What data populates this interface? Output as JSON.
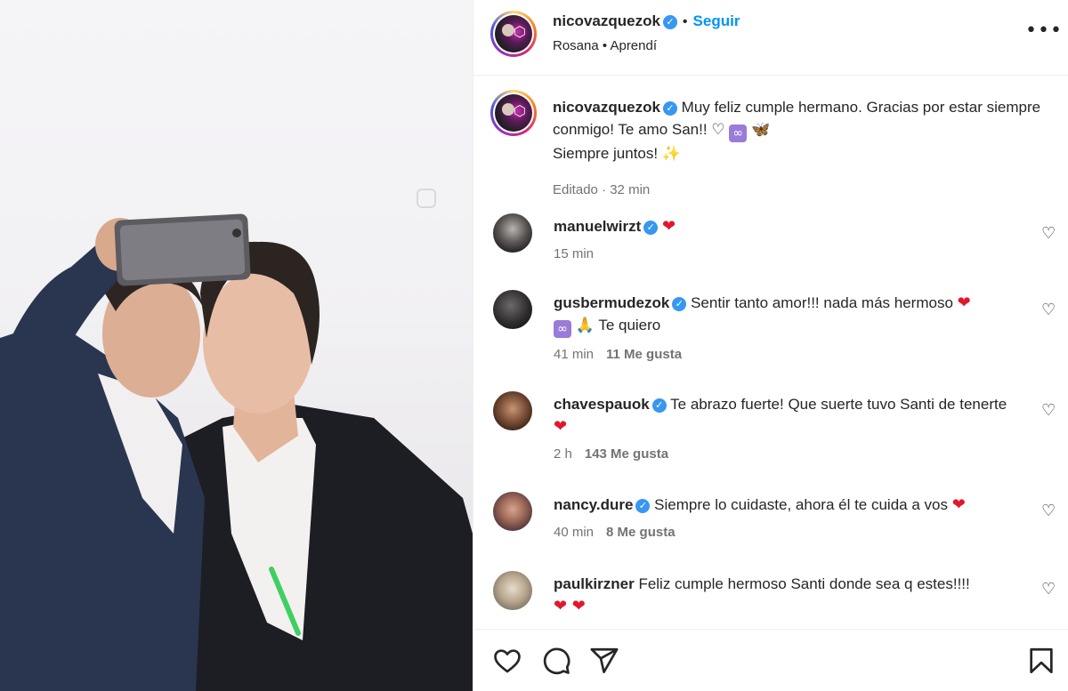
{
  "header": {
    "username": "nicovazquezok",
    "separator": "•",
    "follow_label": "Seguir",
    "audio_artist": "Rosana",
    "audio_song": "Aprendí",
    "more_label": "•••"
  },
  "caption": {
    "username": "nicovazquezok",
    "text": "Muy feliz cumple hermano. Gracias por estar siempre conmigo! Te amo San!! ♡ ",
    "emoji_infinity": "∞",
    "emoji_butterfly": "🦋",
    "line2": "Siempre juntos! ",
    "emoji_sparkles": "✨",
    "edited": "Editado",
    "time": "32 min"
  },
  "comments": [
    {
      "username": "manuelwirzt",
      "text": "",
      "emoji_after": "❤",
      "time": "15 min",
      "likes": ""
    },
    {
      "username": "gusbermudezok",
      "text": "Sentir tanto amor!!! nada más hermoso ",
      "emoji_after": "❤",
      "extra": "🙏 Te quiero",
      "time": "41 min",
      "likes": "11 Me gusta"
    },
    {
      "username": "chavespauok",
      "text": "Te abrazo fuerte! Que suerte tuvo Santi de tenerte",
      "emoji_after": "❤",
      "time": "2 h",
      "likes": "143 Me gusta"
    },
    {
      "username": "nancy.dure",
      "text": "Siempre lo cuidaste, ahora él te cuida a vos ",
      "emoji_after": "❤",
      "time": "40 min",
      "likes": "8 Me gusta"
    },
    {
      "username": "paulkirzner",
      "text": "Feliz cumple hermoso Santi donde sea q estes!!!!",
      "emoji_after": "❤ ❤",
      "time": "",
      "likes": ""
    }
  ],
  "icons": {
    "verified": "✓",
    "heart_outline": "♡",
    "like": "heart-icon",
    "comment": "comment-icon",
    "share": "share-icon",
    "save": "bookmark-icon"
  },
  "colors": {
    "accent": "#0095f6",
    "verified": "#3897f0",
    "heart": "#e0182d"
  }
}
